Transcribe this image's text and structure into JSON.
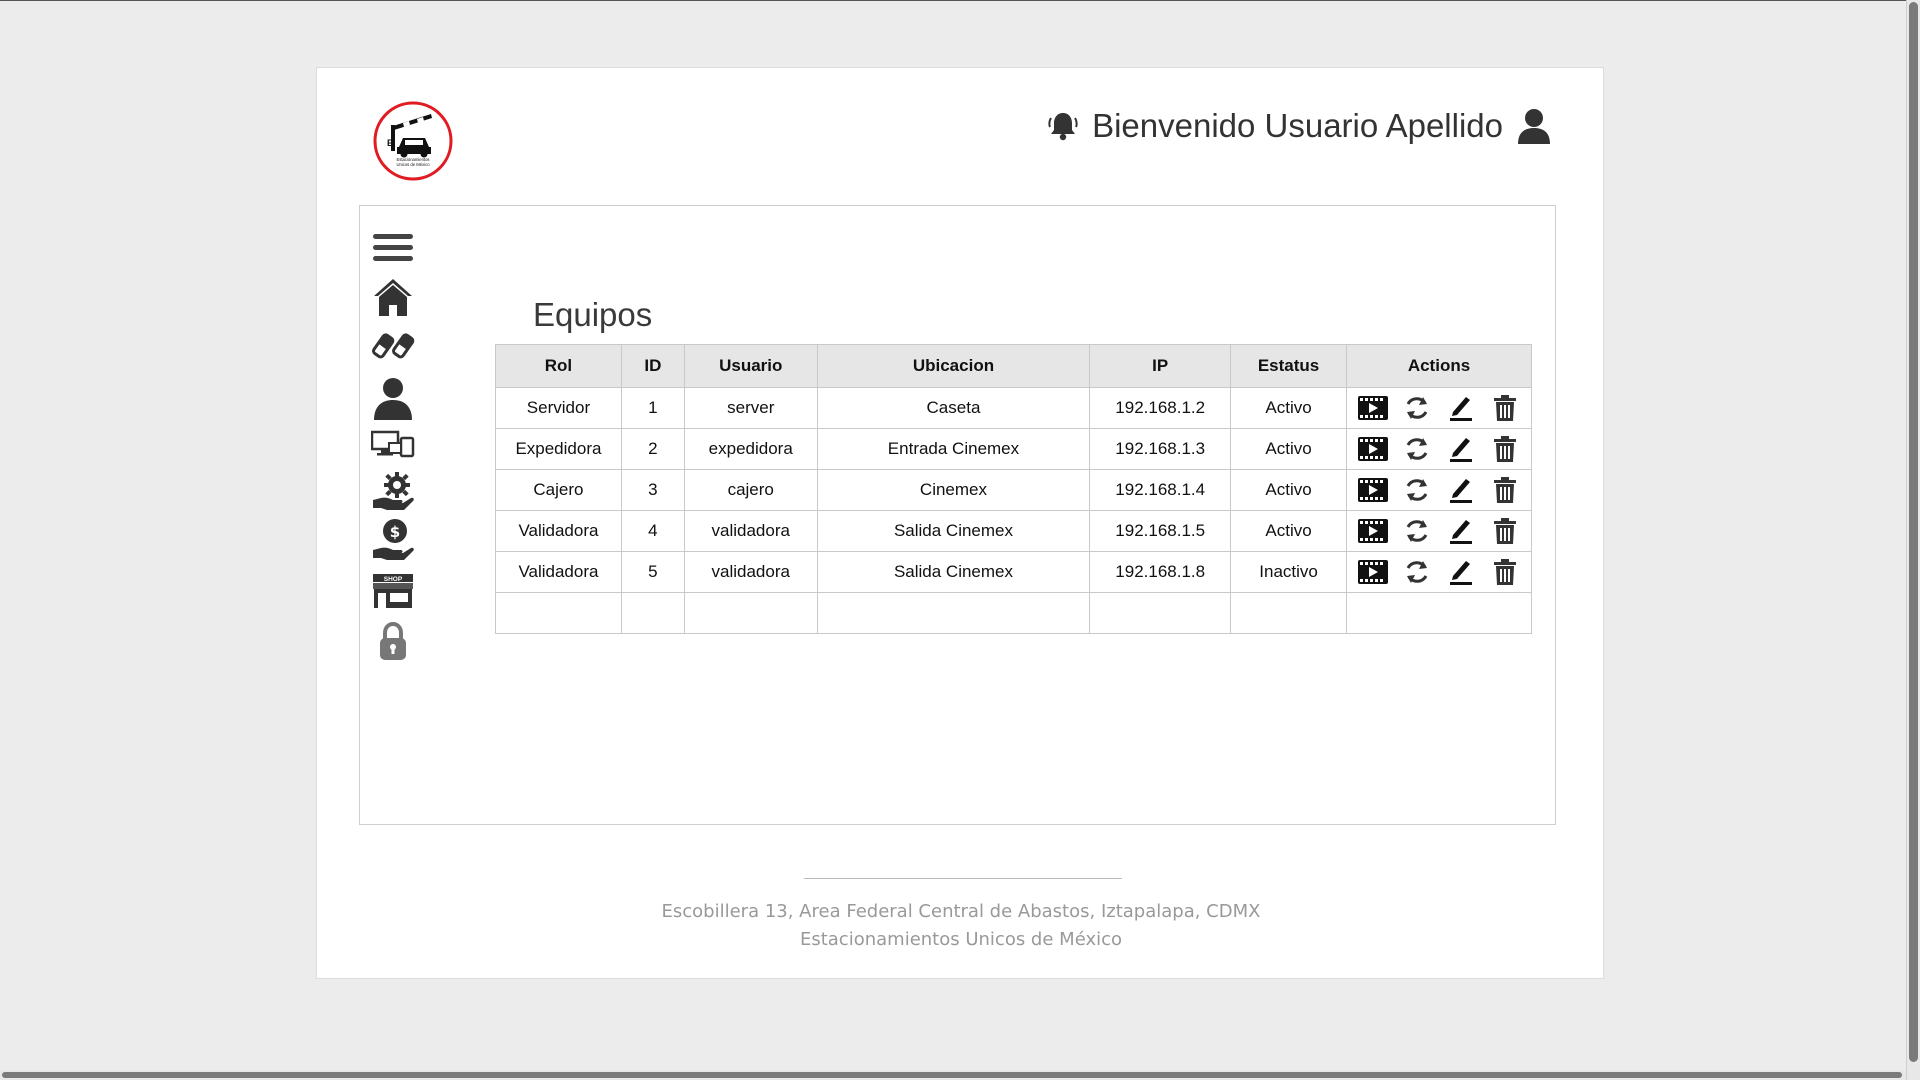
{
  "header": {
    "greeting": "Bienvenido Usuario Apellido",
    "logo": {
      "line1": "Estacionamientos",
      "line2": "Unicos de México",
      "letters": "EUM",
      "ring_color": "#e11b22"
    }
  },
  "sidebar": {
    "items": [
      {
        "name": "menu",
        "icon": "hamburger-icon"
      },
      {
        "name": "home",
        "icon": "home-icon"
      },
      {
        "name": "tickets",
        "icon": "tickets-icon"
      },
      {
        "name": "users",
        "icon": "user-icon"
      },
      {
        "name": "devices",
        "icon": "devices-icon"
      },
      {
        "name": "settings",
        "icon": "settings-hand-icon"
      },
      {
        "name": "payments",
        "icon": "money-hand-icon"
      },
      {
        "name": "shop",
        "icon": "shop-icon",
        "label": "SHOP"
      },
      {
        "name": "lock",
        "icon": "lock-icon"
      }
    ]
  },
  "main": {
    "title": "Equipos",
    "table": {
      "headers": [
        "Rol",
        "ID",
        "Usuario",
        "Ubicacion",
        "IP",
        "Estatus",
        "Actions"
      ],
      "rows": [
        {
          "rol": "Servidor",
          "id": "1",
          "usuario": "server",
          "ubicacion": "Caseta",
          "ip": "192.168.1.2",
          "estatus": "Activo"
        },
        {
          "rol": "Expedidora",
          "id": "2",
          "usuario": "expedidora",
          "ubicacion": "Entrada Cinemex",
          "ip": "192.168.1.3",
          "estatus": "Activo"
        },
        {
          "rol": "Cajero",
          "id": "3",
          "usuario": "cajero",
          "ubicacion": "Cinemex",
          "ip": "192.168.1.4",
          "estatus": "Activo"
        },
        {
          "rol": "Validadora",
          "id": "4",
          "usuario": "validadora",
          "ubicacion": "Salida Cinemex",
          "ip": "192.168.1.5",
          "estatus": "Activo"
        },
        {
          "rol": "Validadora",
          "id": "5",
          "usuario": "validadora",
          "ubicacion": "Salida Cinemex",
          "ip": "192.168.1.8",
          "estatus": "Inactivo"
        }
      ],
      "action_icons": [
        "video-icon",
        "refresh-icon",
        "edit-icon",
        "trash-icon"
      ]
    }
  },
  "footer": {
    "address": "Escobillera 13, Area Federal Central de Abastos, Iztapalapa, CDMX",
    "company": "Estacionamientos Unicos de México"
  }
}
